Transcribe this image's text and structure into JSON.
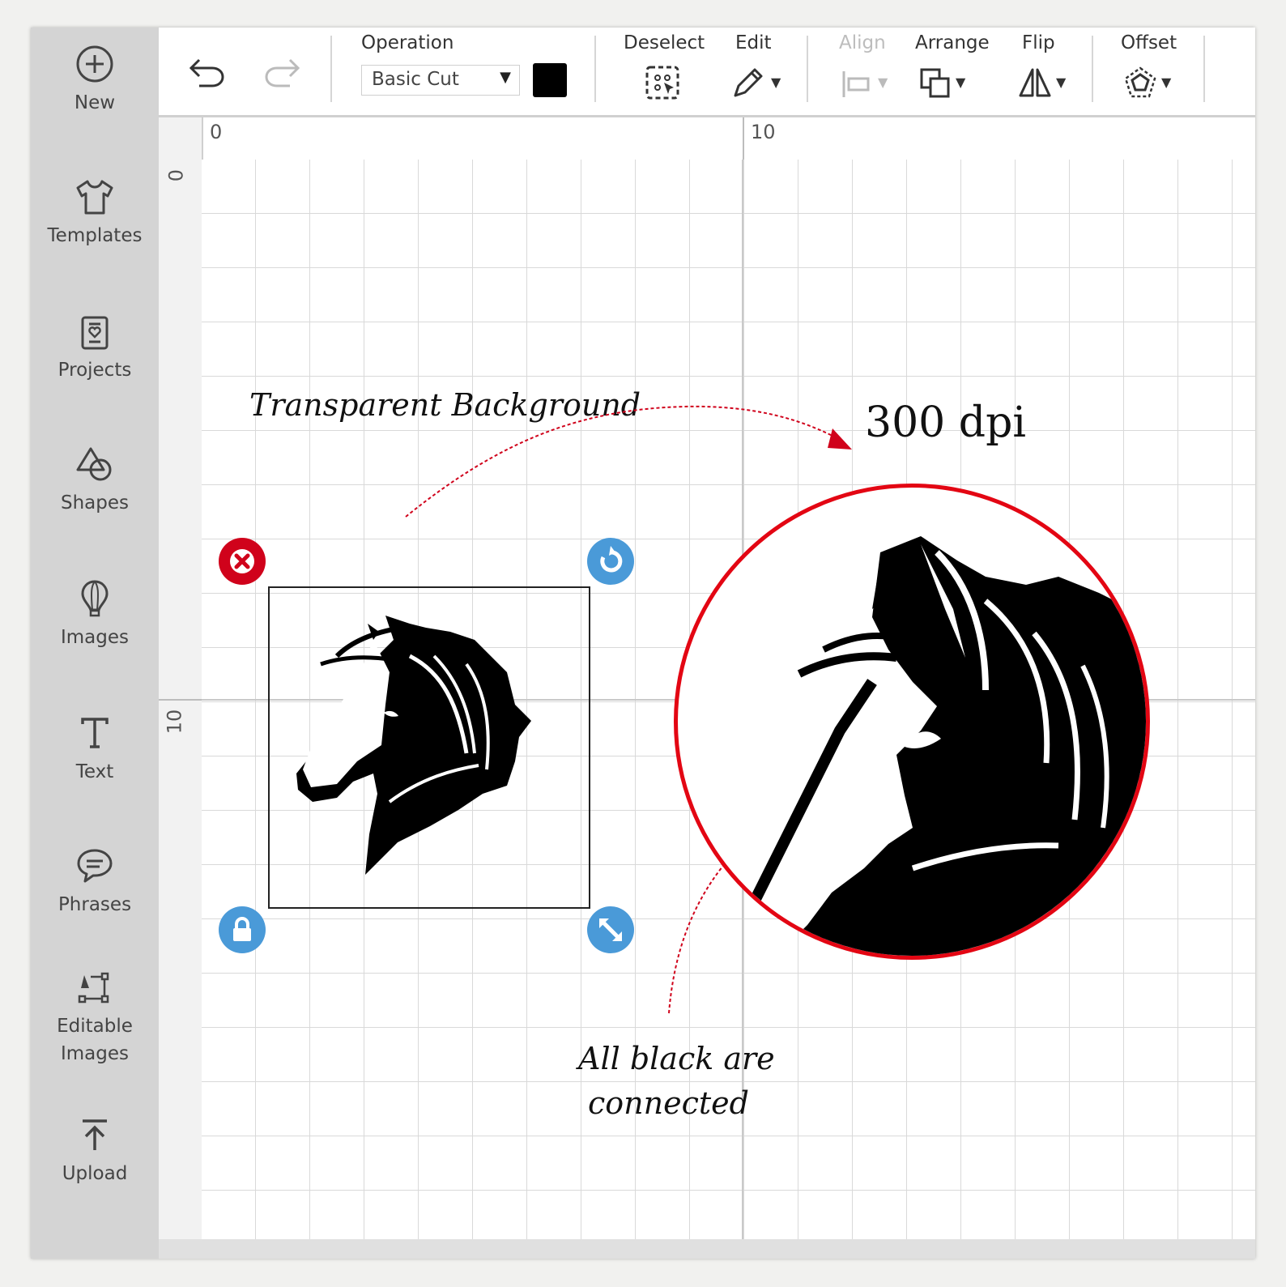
{
  "sidebar": {
    "items": [
      {
        "label": "New",
        "icon": "plus-circle-icon"
      },
      {
        "label": "Templates",
        "icon": "tshirt-icon"
      },
      {
        "label": "Projects",
        "icon": "projects-icon"
      },
      {
        "label": "Shapes",
        "icon": "shapes-icon"
      },
      {
        "label": "Images",
        "icon": "balloon-icon"
      },
      {
        "label": "Text",
        "icon": "text-t-icon"
      },
      {
        "label": "Phrases",
        "icon": "speech-bubble-icon"
      },
      {
        "label": "Editable",
        "label2": "Images",
        "icon": "editable-images-icon"
      },
      {
        "label": "Upload",
        "icon": "upload-icon"
      }
    ]
  },
  "toolbar": {
    "operation_label": "Operation",
    "operation_value": "Basic Cut",
    "color": "#000000",
    "deselect_label": "Deselect",
    "edit_label": "Edit",
    "align_label": "Align",
    "arrange_label": "Arrange",
    "flip_label": "Flip",
    "offset_label": "Offset"
  },
  "rulers": {
    "top": [
      "0",
      "10"
    ],
    "left": [
      "0",
      "10"
    ]
  },
  "annotations": {
    "transparent": "Transparent Background",
    "dpi": "300 dpi",
    "connected_line1": "All black are",
    "connected_line2": "connected"
  },
  "colors": {
    "delete_handle": "#d0021b",
    "blue_handle": "#4a9ad8",
    "magnifier_ring": "#e30613",
    "sidebar": "#d4d4d4"
  }
}
